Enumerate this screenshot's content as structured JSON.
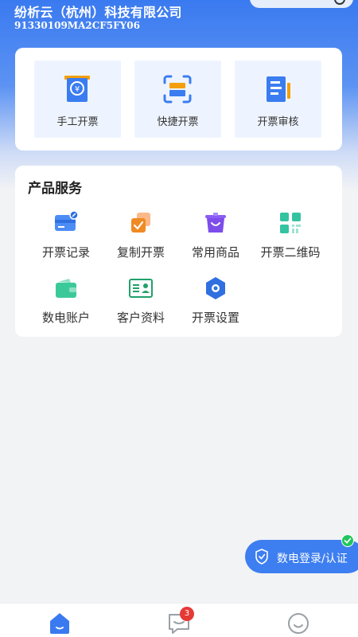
{
  "header": {
    "company_name": "纷析云（杭州）科技有限公司",
    "tax_id": "91330109MA2CF5FY06"
  },
  "quick_actions": [
    {
      "label": "手工开票",
      "icon": "manual-invoice-icon"
    },
    {
      "label": "快捷开票",
      "icon": "scan-invoice-icon"
    },
    {
      "label": "开票审核",
      "icon": "invoice-review-icon"
    }
  ],
  "services": {
    "title": "产品服务",
    "items": [
      {
        "label": "开票记录",
        "icon": "invoice-record-icon"
      },
      {
        "label": "复制开票",
        "icon": "copy-invoice-icon"
      },
      {
        "label": "常用商品",
        "icon": "common-goods-icon"
      },
      {
        "label": "开票二维码",
        "icon": "invoice-qrcode-icon"
      },
      {
        "label": "数电账户",
        "icon": "digital-account-icon"
      },
      {
        "label": "客户资料",
        "icon": "customer-info-icon"
      },
      {
        "label": "开票设置",
        "icon": "invoice-settings-icon"
      }
    ]
  },
  "float_button": {
    "label": "数电登录/认证",
    "icon": "shield-icon",
    "verified_icon": "check-icon"
  },
  "tabbar": {
    "tabs": [
      {
        "name": "home",
        "icon": "home-icon",
        "active": true
      },
      {
        "name": "messages",
        "icon": "message-icon",
        "badge": "3"
      },
      {
        "name": "profile",
        "icon": "profile-icon"
      }
    ]
  },
  "colors": {
    "brand_blue": "#3a7af0",
    "badge_red": "#e53935",
    "verified_green": "#22c55e"
  }
}
